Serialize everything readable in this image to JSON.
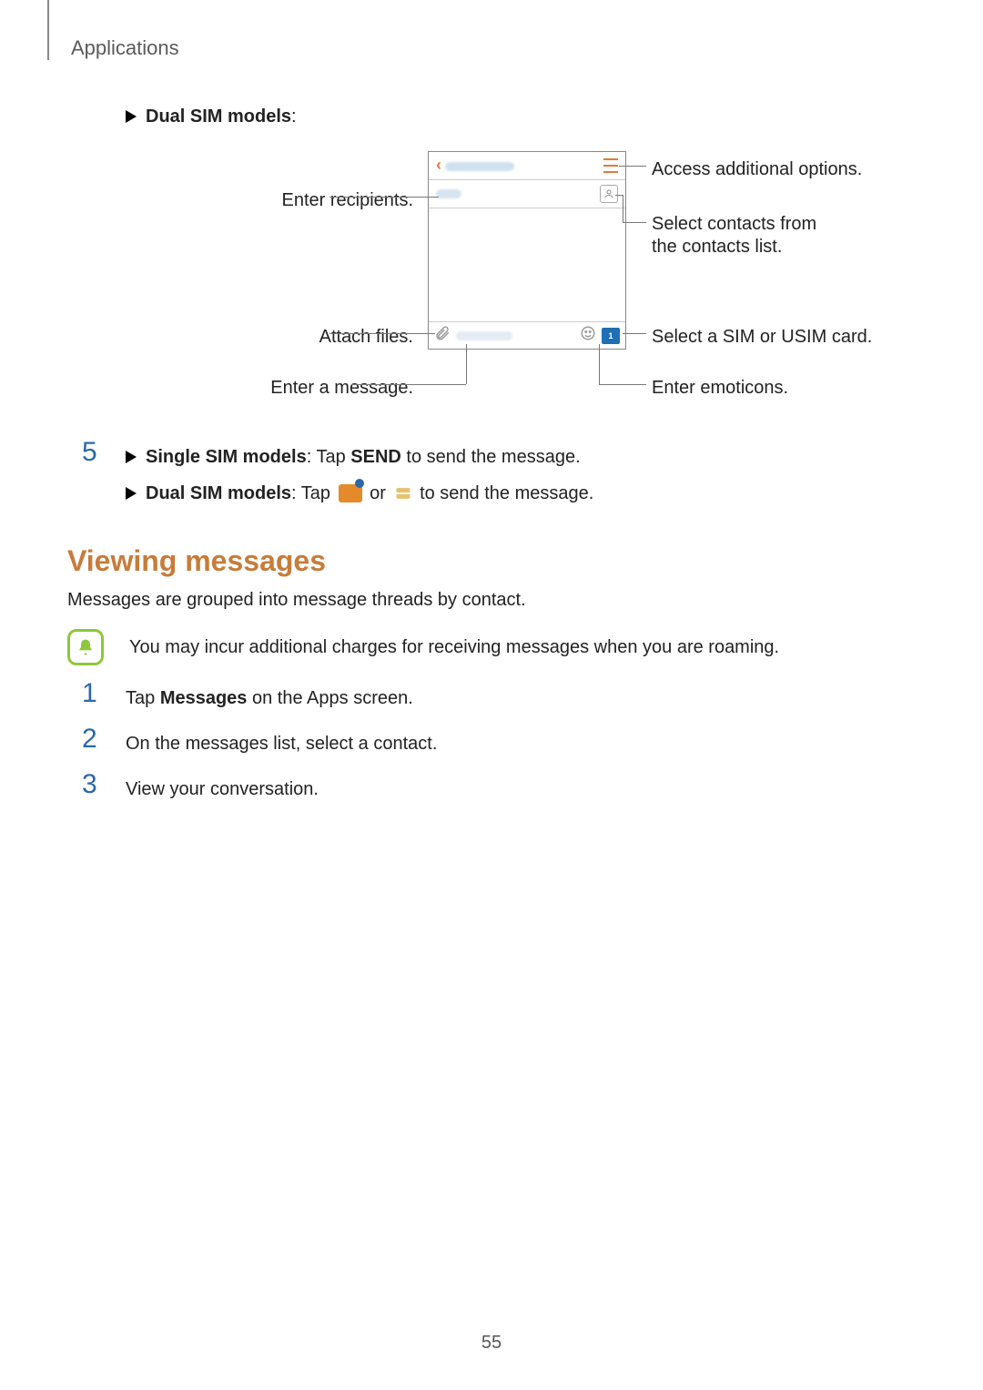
{
  "breadcrumb": "Applications",
  "headings": {
    "dual_sim_models": "Dual SIM models",
    "viewing": "Viewing messages"
  },
  "diagram": {
    "labels": {
      "enter_recipients": "Enter recipients.",
      "attach_files": "Attach files.",
      "enter_message": "Enter a message.",
      "access_options": "Access additional options.",
      "select_contacts": "Select contacts from the contacts list.",
      "select_sim": "Select a SIM or USIM card.",
      "enter_emoticons": "Enter emoticons."
    }
  },
  "step5": {
    "number": "5",
    "single_label": "Single SIM models",
    "single_rest_1": ": Tap ",
    "single_send": "SEND",
    "single_rest_2": " to send the message.",
    "dual_label": "Dual SIM models",
    "dual_rest_1": ": Tap ",
    "dual_or": " or ",
    "dual_rest_2": " to send the message."
  },
  "viewing_intro": "Messages are grouped into message threads by contact.",
  "note": "You may incur additional charges for receiving messages when you are roaming.",
  "steps_view": {
    "s1": {
      "n": "1",
      "pre": "Tap ",
      "bold": "Messages",
      "post": " on the Apps screen."
    },
    "s2": {
      "n": "2",
      "text": "On the messages list, select a contact."
    },
    "s3": {
      "n": "3",
      "text": "View your conversation."
    }
  },
  "page_number": "55"
}
